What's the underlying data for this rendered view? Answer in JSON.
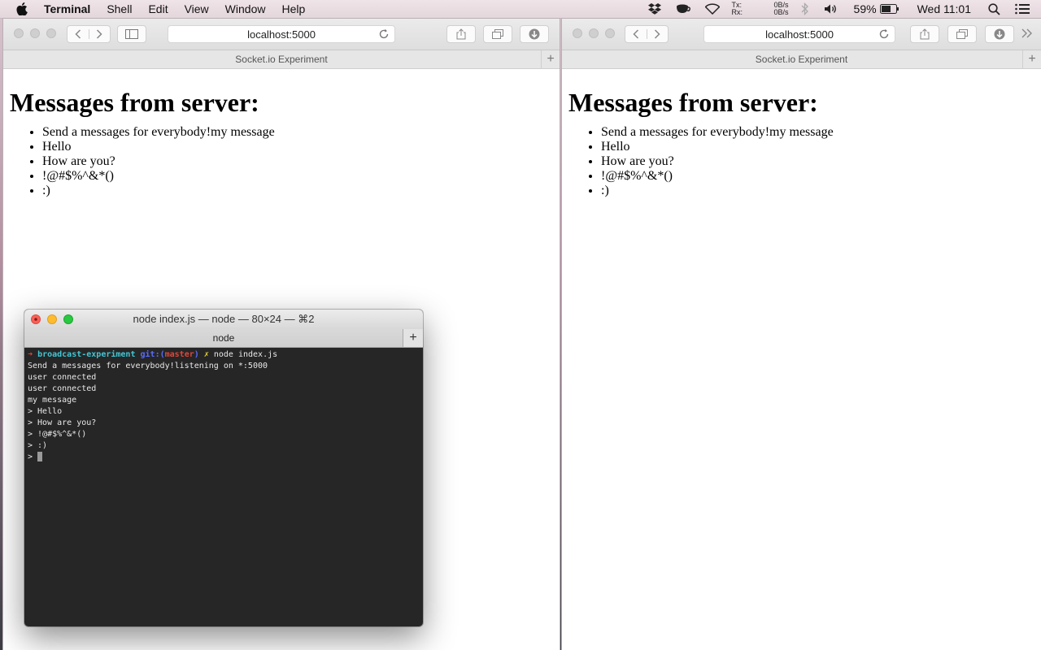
{
  "menubar": {
    "app_name": "Terminal",
    "items": [
      "Shell",
      "Edit",
      "View",
      "Window",
      "Help"
    ],
    "network": {
      "tx_label": "Tx:",
      "tx_value": "0B/s",
      "rx_label": "Rx:",
      "rx_value": "0B/s"
    },
    "battery_percent": "59%",
    "clock": "Wed 11:01"
  },
  "browser_left": {
    "url": "localhost:5000",
    "tab_title": "Socket.io Experiment",
    "heading": "Messages from server:",
    "messages": [
      "Send a messages for everybody!my message",
      "Hello",
      "How are you?",
      "!@#$%^&*()",
      ":)"
    ]
  },
  "browser_right": {
    "url": "localhost:5000",
    "tab_title": "Socket.io Experiment",
    "heading": "Messages from server:",
    "messages": [
      "Send a messages for everybody!my message",
      "Hello",
      "How are you?",
      "!@#$%^&*()",
      ":)"
    ]
  },
  "terminal": {
    "title": "node index.js — node — 80×24 — ⌘2",
    "tab_label": "node",
    "prompt": {
      "arrow": "➜",
      "dir": "broadcast-experiment",
      "git_prefix": "git:(",
      "branch": "master",
      "git_suffix": ")",
      "dirty_mark": "✗",
      "command": "node index.js"
    },
    "output_lines": [
      "Send a messages for everybody!listening on *:5000",
      "user connected",
      "user connected",
      "my message",
      "> Hello",
      "> How are you?",
      "> !@#$%^&*()",
      "> :)"
    ],
    "current_prompt": "> "
  },
  "colors": {
    "terminal_bg": "#262626",
    "prompt_arrow": "#e0463a",
    "prompt_dir": "#41c7d6",
    "prompt_git": "#5a6bff",
    "prompt_dirty": "#e3d03a"
  }
}
